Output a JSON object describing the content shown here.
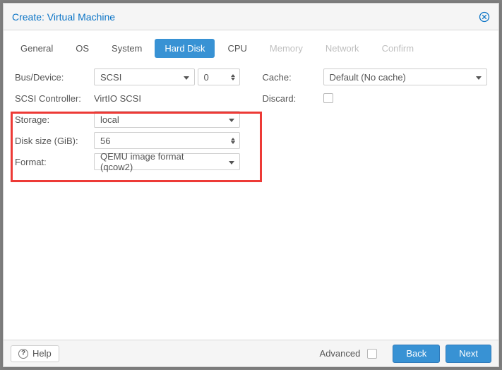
{
  "header": {
    "title": "Create: Virtual Machine"
  },
  "tabs": [
    {
      "label": "General",
      "state": "normal"
    },
    {
      "label": "OS",
      "state": "normal"
    },
    {
      "label": "System",
      "state": "normal"
    },
    {
      "label": "Hard Disk",
      "state": "active"
    },
    {
      "label": "CPU",
      "state": "normal"
    },
    {
      "label": "Memory",
      "state": "disabled"
    },
    {
      "label": "Network",
      "state": "disabled"
    },
    {
      "label": "Confirm",
      "state": "disabled"
    }
  ],
  "left": {
    "bus_device": {
      "label": "Bus/Device:",
      "bus": "SCSI",
      "index": "0"
    },
    "scsi_ctrl": {
      "label": "SCSI Controller:",
      "value": "VirtIO SCSI"
    },
    "storage": {
      "label": "Storage:",
      "value": "local"
    },
    "disk_size": {
      "label": "Disk size (GiB):",
      "value": "56"
    },
    "format": {
      "label": "Format:",
      "value": "QEMU image format (qcow2)"
    }
  },
  "right": {
    "cache": {
      "label": "Cache:",
      "value": "Default (No cache)"
    },
    "discard": {
      "label": "Discard:",
      "checked": false
    }
  },
  "footer": {
    "help": "Help",
    "advanced": "Advanced",
    "back": "Back",
    "next": "Next",
    "advanced_checked": false
  },
  "colors": {
    "accent": "#3892d4",
    "header_text": "#0b74c6",
    "highlight": "#ed3a36"
  }
}
